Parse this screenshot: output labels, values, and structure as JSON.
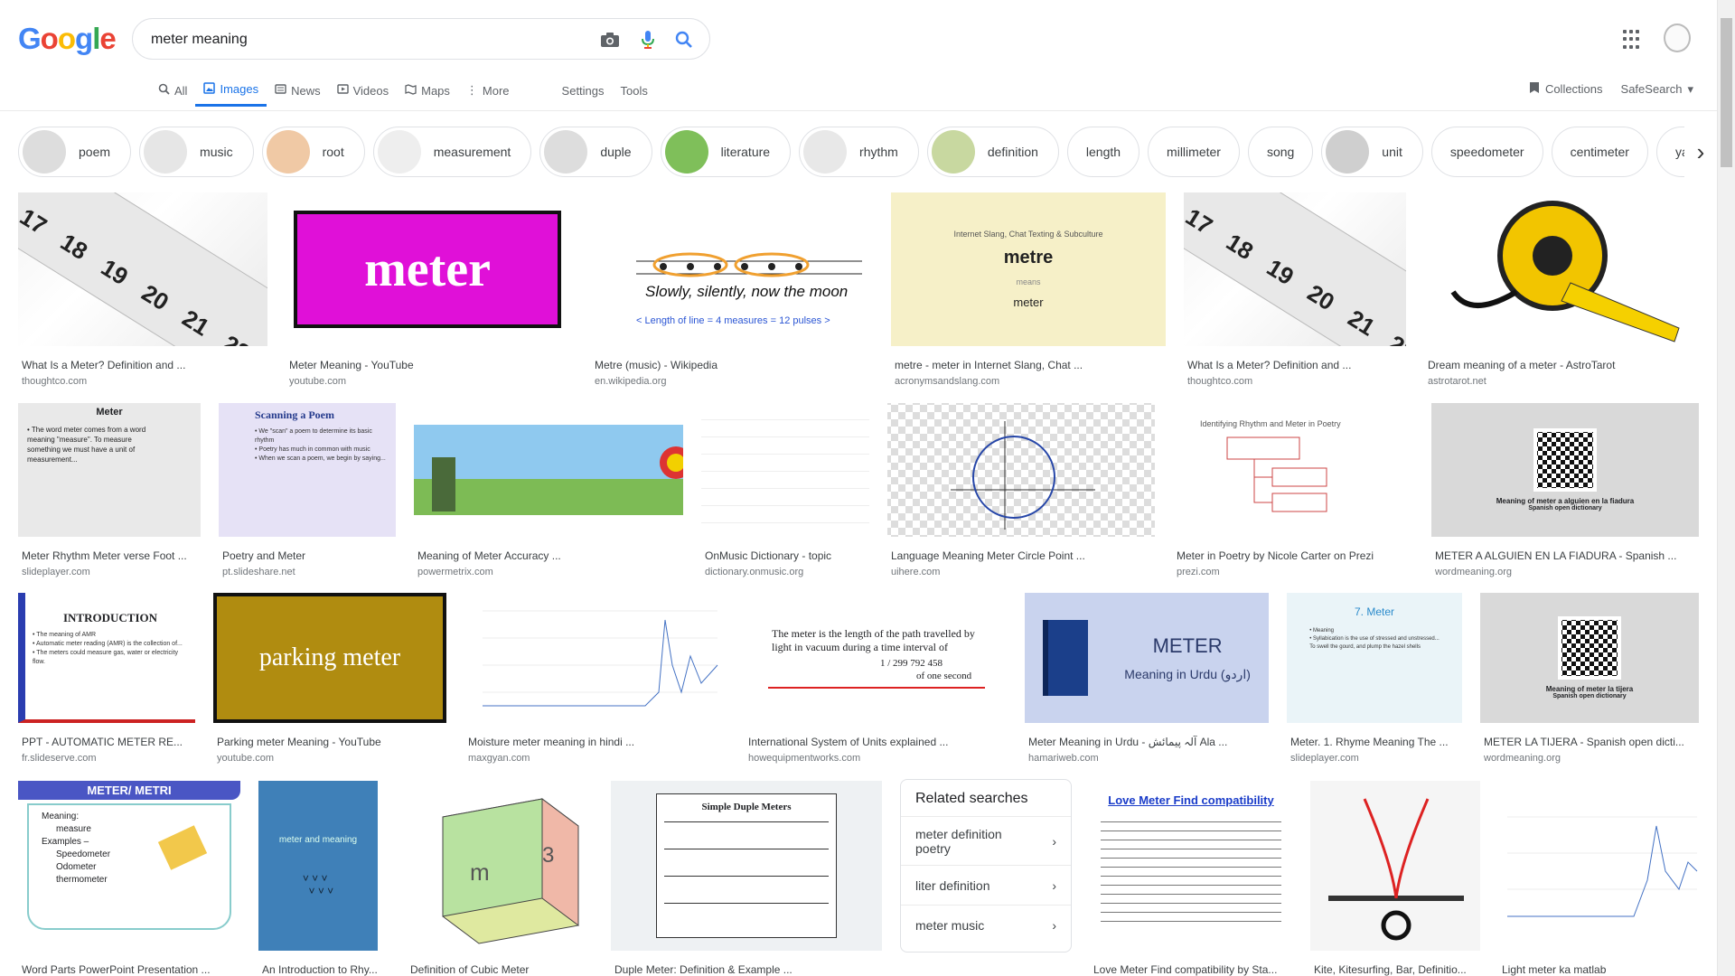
{
  "logo": {
    "letters": [
      "G",
      "o",
      "o",
      "g",
      "l",
      "e"
    ],
    "colors": [
      "#4285f4",
      "#ea4335",
      "#fbbc05",
      "#4285f4",
      "#34a853",
      "#ea4335"
    ]
  },
  "search": {
    "value": "meter meaning"
  },
  "tabs": [
    {
      "label": "All",
      "icon": "search-icon"
    },
    {
      "label": "Images",
      "icon": "image-icon",
      "active": true
    },
    {
      "label": "News",
      "icon": "news-icon"
    },
    {
      "label": "Videos",
      "icon": "video-icon"
    },
    {
      "label": "Maps",
      "icon": "map-icon"
    },
    {
      "label": "More",
      "icon": "more-vert-icon"
    }
  ],
  "tools": {
    "settings": "Settings",
    "tools": "Tools"
  },
  "right": {
    "collections": "Collections",
    "safesearch": "SafeSearch"
  },
  "chips": [
    {
      "label": "poem",
      "thumb": true
    },
    {
      "label": "music",
      "thumb": true
    },
    {
      "label": "root",
      "thumb": true
    },
    {
      "label": "measurement",
      "thumb": true
    },
    {
      "label": "duple",
      "thumb": true
    },
    {
      "label": "literature",
      "thumb": true
    },
    {
      "label": "rhythm",
      "thumb": true
    },
    {
      "label": "definition",
      "thumb": true
    },
    {
      "label": "length",
      "thumb": false
    },
    {
      "label": "millimeter",
      "thumb": false
    },
    {
      "label": "song",
      "thumb": false
    },
    {
      "label": "unit",
      "thumb": true
    },
    {
      "label": "speedometer",
      "thumb": false
    },
    {
      "label": "centimeter",
      "thumb": false
    },
    {
      "label": "yard",
      "thumb": false
    }
  ],
  "results": [
    {
      "title": "What Is a Meter? Definition and ...",
      "source": "thoughtco.com"
    },
    {
      "title": "Meter Meaning - YouTube",
      "source": "youtube.com",
      "img_text": "meter"
    },
    {
      "title": "Metre (music) - Wikipedia",
      "source": "en.wikipedia.org",
      "img_text": "Slowly, silently, now the moon",
      "img_caption": "< Length of line = 4 measures = 12 pulses >"
    },
    {
      "title": "metre - meter in Internet Slang, Chat ...",
      "source": "acronymsandslang.com",
      "img_head": "Internet Slang, Chat Texting & Subculture",
      "img_word": "metre",
      "img_means": "means",
      "img_meaning": "meter"
    },
    {
      "title": "What Is a Meter? Definition and ...",
      "source": "thoughtco.com"
    },
    {
      "title": "Dream meaning of a meter - AstroTarot",
      "source": "astrotarot.net"
    },
    {
      "title": "Meter Rhythm Meter verse Foot ...",
      "source": "slideplayer.com",
      "img_head": "Meter"
    },
    {
      "title": "Poetry and Meter",
      "source": "pt.slideshare.net",
      "img_head": "Scanning a Poem"
    },
    {
      "title": "Meaning of Meter Accuracy ...",
      "source": "powermetrix.com"
    },
    {
      "title": "OnMusic Dictionary - topic",
      "source": "dictionary.onmusic.org"
    },
    {
      "title": "Language Meaning Meter Circle Point ...",
      "source": "uihere.com"
    },
    {
      "title": "Meter in Poetry by Nicole Carter on Prezi",
      "source": "prezi.com",
      "img_head": "Identifying Rhythm and Meter in Poetry"
    },
    {
      "title": "METER A ALGUIEN EN LA FIADURA - Spanish ...",
      "source": "wordmeaning.org",
      "img_head": "Meaning of meter a alguien en la fiadura",
      "img_sub": "Spanish open dictionary"
    },
    {
      "title": "PPT - AUTOMATIC METER RE...",
      "source": "fr.slideserve.com",
      "img_head": "INTRODUCTION"
    },
    {
      "title": "Parking meter Meaning - YouTube",
      "source": "youtube.com",
      "img_text": "parking meter"
    },
    {
      "title": "Moisture meter meaning in hindi ...",
      "source": "maxgyan.com"
    },
    {
      "title": "International System of Units explained ...",
      "source": "howequipmentworks.com",
      "img_text": "The meter is the length of the path travelled by light in vacuum during a time interval of",
      "img_frac": "1 / 299 792 458",
      "img_tail": "of one second"
    },
    {
      "title": "Meter Meaning in Urdu - ‎آلہ پیمائش‎ Ala ...",
      "source": "hamariweb.com",
      "img_word": "METER",
      "img_sub": "Meaning in Urdu (اردو)"
    },
    {
      "title": "Meter. 1. Rhyme Meaning The ...",
      "source": "slideplayer.com",
      "img_head": "7. Meter"
    },
    {
      "title": "METER LA TIJERA - Spanish open dicti...",
      "source": "wordmeaning.org",
      "img_head": "Meaning of meter la tijera",
      "img_sub": "Spanish open dictionary"
    },
    {
      "title": "Word Parts PowerPoint Presentation ...",
      "source": "",
      "img_head": "METER/ METRI",
      "img_bullets": [
        "Meaning:",
        "measure",
        "Examples –",
        "Speedometer",
        "Odometer",
        "thermometer"
      ]
    },
    {
      "title": "An Introduction to Rhy...",
      "source": "",
      "img_text": "meter and meaning"
    },
    {
      "title": "Definition of Cubic Meter",
      "source": ""
    },
    {
      "title": "Duple Meter: Definition & Example ...",
      "source": "",
      "img_head": "Simple Duple Meters"
    },
    {
      "title": "Love Meter Find compatibility by Sta...",
      "source": "",
      "img_head": "Love Meter Find compatibility"
    },
    {
      "title": "Kite, Kitesurfing, Bar, Definitio...",
      "source": ""
    },
    {
      "title": "Light meter ka matlab",
      "source": ""
    }
  ],
  "related": {
    "heading": "Related searches",
    "items": [
      "meter definition poetry",
      "liter definition",
      "meter music"
    ]
  }
}
